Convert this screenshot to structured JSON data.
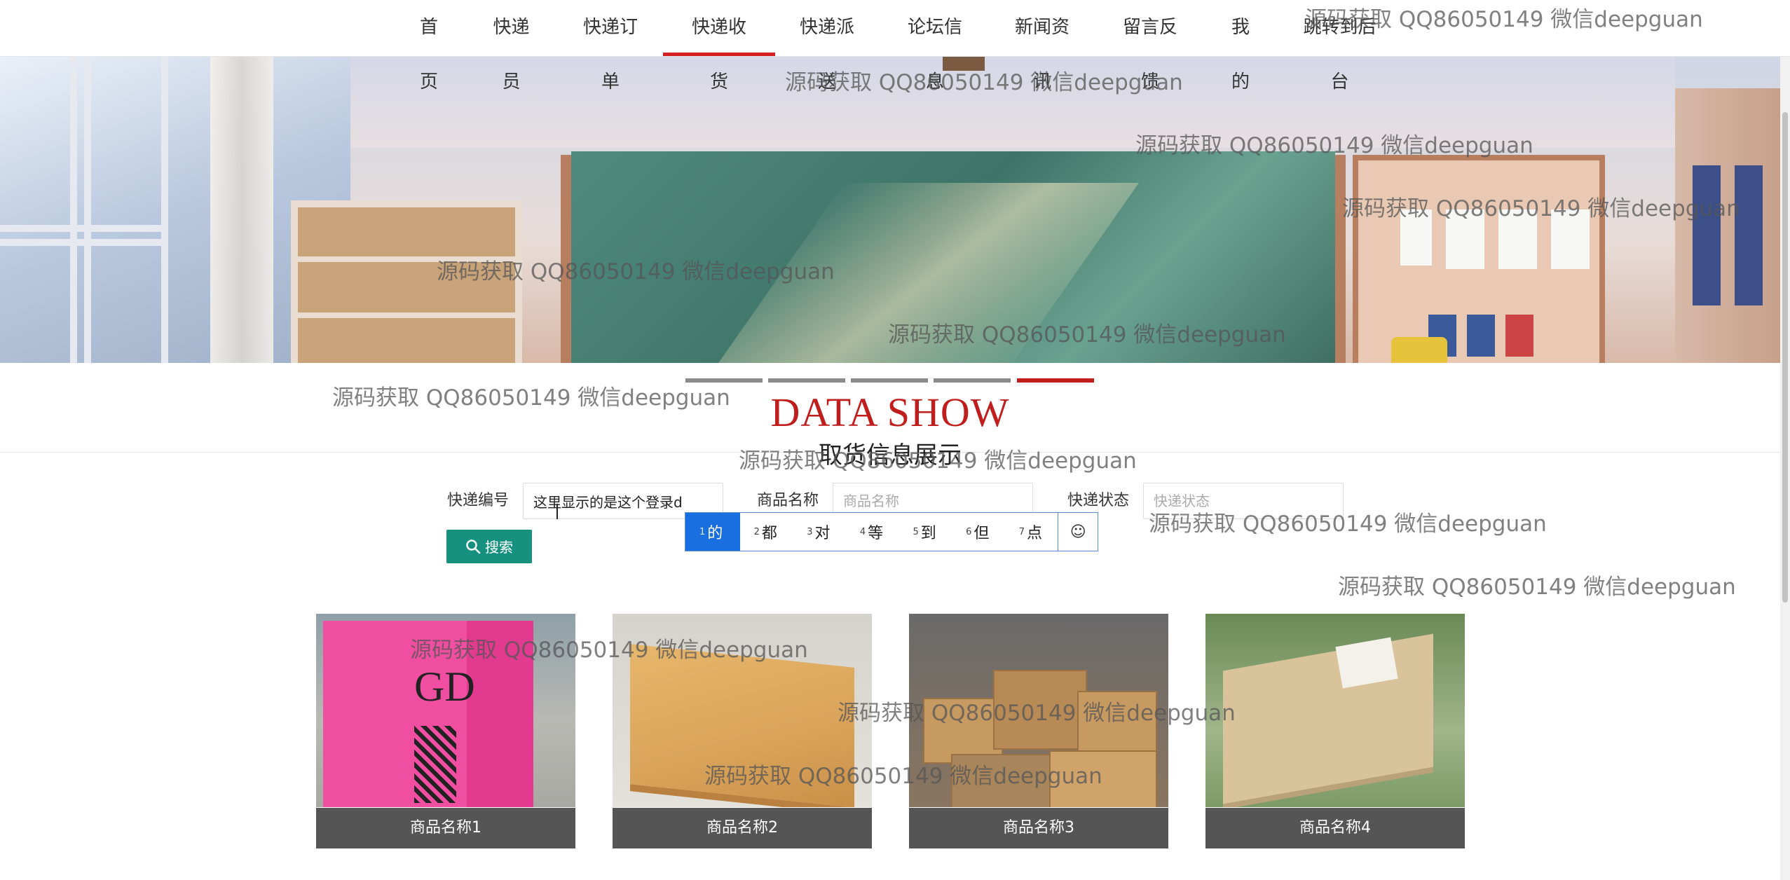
{
  "nav": {
    "items": [
      "首页",
      "快递员",
      "快递订单",
      "快递收货",
      "快递派送",
      "论坛信息",
      "新闻资讯",
      "留言反馈",
      "我的",
      "跳转到后台"
    ],
    "active_index": 3
  },
  "section": {
    "title_en": "DATA SHOW",
    "title_cn": "取货信息展示"
  },
  "search": {
    "tracking_label": "快递编号",
    "tracking_value": "这里显示的是这个登录d",
    "goods_label": "商品名称",
    "goods_placeholder": "商品名称",
    "status_label": "快递状态",
    "status_placeholder": "快递状态",
    "button_label": "搜索"
  },
  "ime": {
    "candidates": [
      {
        "num": "1",
        "text": "的"
      },
      {
        "num": "2",
        "text": "都"
      },
      {
        "num": "3",
        "text": "对"
      },
      {
        "num": "4",
        "text": "等"
      },
      {
        "num": "5",
        "text": "到"
      },
      {
        "num": "6",
        "text": "但"
      },
      {
        "num": "7",
        "text": "点"
      }
    ],
    "emoji_icon": "☺"
  },
  "carousel": {
    "count": 5,
    "active_index": 4
  },
  "products": [
    {
      "name": "商品名称1"
    },
    {
      "name": "商品名称2"
    },
    {
      "name": "商品名称3"
    },
    {
      "name": "商品名称4"
    }
  ],
  "watermark": "源码获取 QQ86050149 微信deepguan",
  "colors": {
    "accent_red": "#c01d1d",
    "button_teal": "#17917f",
    "ime_blue": "#1a6fe0"
  }
}
